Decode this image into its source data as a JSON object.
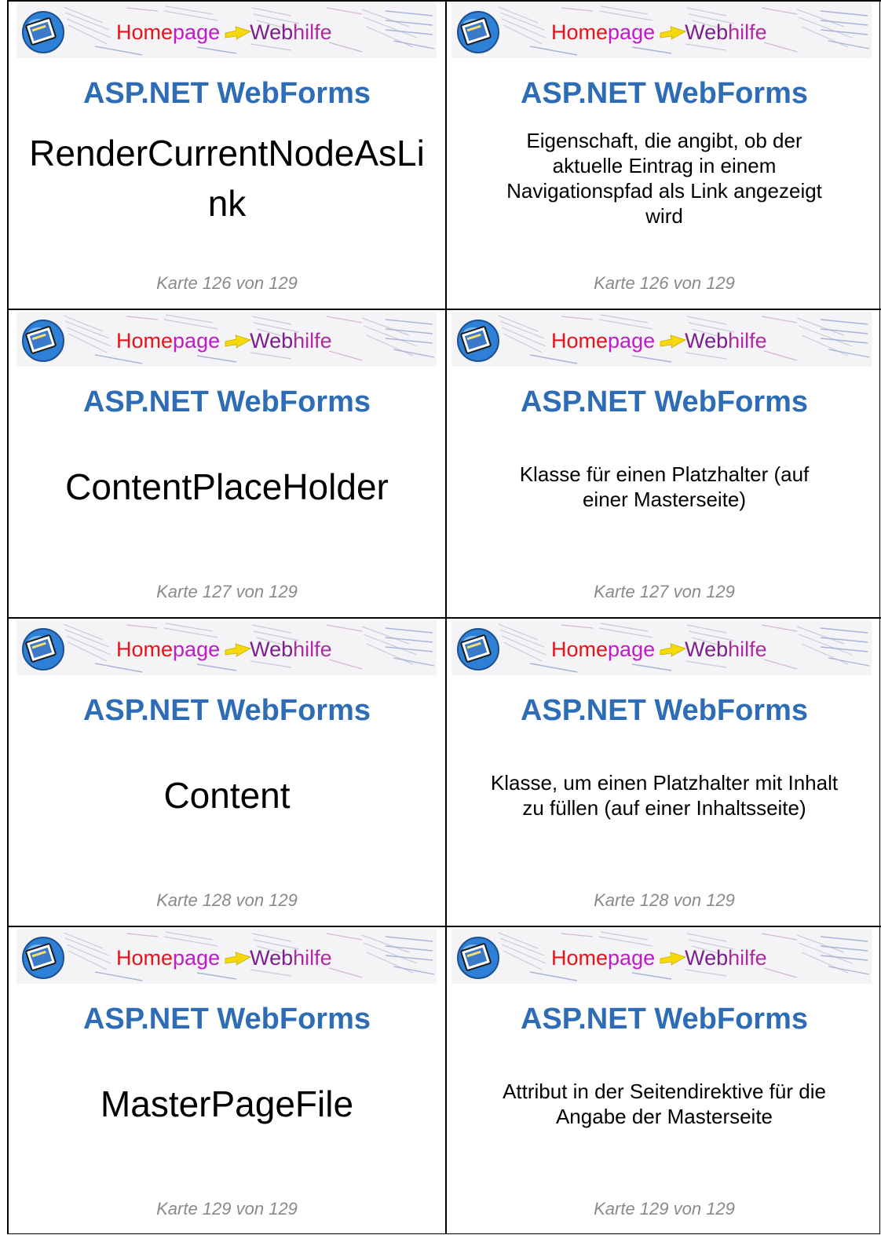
{
  "banner": {
    "logo_icon": "globe-laptop-logo-icon",
    "brand_part1": "Home",
    "brand_part2": "page",
    "brand_part3": "Web",
    "brand_part4": "hilfe",
    "arrow_icon": "yellow-arrow-icon",
    "colors": {
      "home": "#e8121b",
      "page": "#c01ac8",
      "web": "#7a1f8c",
      "hilfe": "#ae2ca2",
      "arrow": "#f5d90a"
    }
  },
  "course_title": "ASP.NET WebForms",
  "accent_color": "#2e6db6",
  "cards": [
    {
      "term_lines": [
        "RenderCurrentNodeAsLi",
        "nk"
      ],
      "definition_lines": [
        "Eigenschaft, die angibt, ob der",
        "aktuelle Eintrag in einem",
        "Navigationspfad als Link angezeigt",
        "wird"
      ],
      "counter": "Karte 126 von 129"
    },
    {
      "term_lines": [
        "ContentPlaceHolder"
      ],
      "definition_lines": [
        "Klasse für einen Platzhalter (auf",
        "einer Masterseite)"
      ],
      "counter": "Karte 127 von 129"
    },
    {
      "term_lines": [
        "Content"
      ],
      "definition_lines": [
        "Klasse, um einen Platzhalter mit Inhalt",
        "zu füllen (auf einer Inhaltsseite)"
      ],
      "counter": "Karte 128 von 129"
    },
    {
      "term_lines": [
        "MasterPageFile"
      ],
      "definition_lines": [
        "Attribut in der Seitendirektive für die",
        "Angabe der Masterseite"
      ],
      "counter": "Karte 129 von 129"
    }
  ]
}
